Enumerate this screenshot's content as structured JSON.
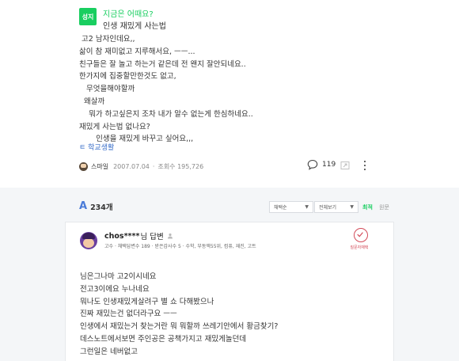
{
  "question": {
    "badge": "성지",
    "title": "지금은 어때요?",
    "subtitle": "인생 재밌게 사는법",
    "body_lines": [
      " 고2 남자인데요,,",
      "삶이 참 재미없고 지루해서요, ㅡㅡ...",
      "친구들은 잘 놀고 하는거 같은데 전 왠지 잘안되네요..",
      "한가지에 집중할만한것도 없고,",
      "   무엇을해야할까",
      "  왜살까",
      "    뭐가 하고싶은지 조차 내가 알수 없는게 한심하네요..",
      "재밌게 사는법 없나요?",
      "       인생을 재밌게 바꾸고 싶어요,,,"
    ],
    "tag": "ㅌ 학교생활",
    "author": "스마일",
    "date": "2007.07.04",
    "views": "조회수 195,726",
    "comment_count": "119",
    "icons": {
      "comment": "comment-icon",
      "share": "share-icon",
      "more": "more-vertical-icon"
    }
  },
  "answers": {
    "logo": "A",
    "count": "234개",
    "sort_select": "채택순",
    "period_select": "전체보기",
    "filter_active": "최적",
    "filter_inactive": "원문"
  },
  "answer": {
    "name_id": "chos****",
    "name_suffix": "님 답변",
    "meta": "고수 · 채택답변수 189 · 받은감사수 5 · 수학, 부동액55위, 컴퓨, 재진, 고트",
    "adopt_label": "질문자채택",
    "body_lines": [
      "님은그나마 고2이시네요",
      "전고3이에요 누나네요",
      "뭐나도 인생재밌게살려구 별 쇼 다해봤으나",
      "진짜 재밌는건 없더라구요 ㅡㅡ",
      "인생에서 재밌는거 찾는거란 뭐 뭐할까 쓰레기안에서 황금찾기?",
      "데스노트에서보면 주인공은 공책가지고 재밌게놀던데",
      "그런일은 네버없고"
    ]
  },
  "colors": {
    "accent_green": "#19ce60",
    "link_blue": "#3a6fc9",
    "adopt_red": "#d34c5a",
    "panel_bg": "#f4f6f8"
  }
}
